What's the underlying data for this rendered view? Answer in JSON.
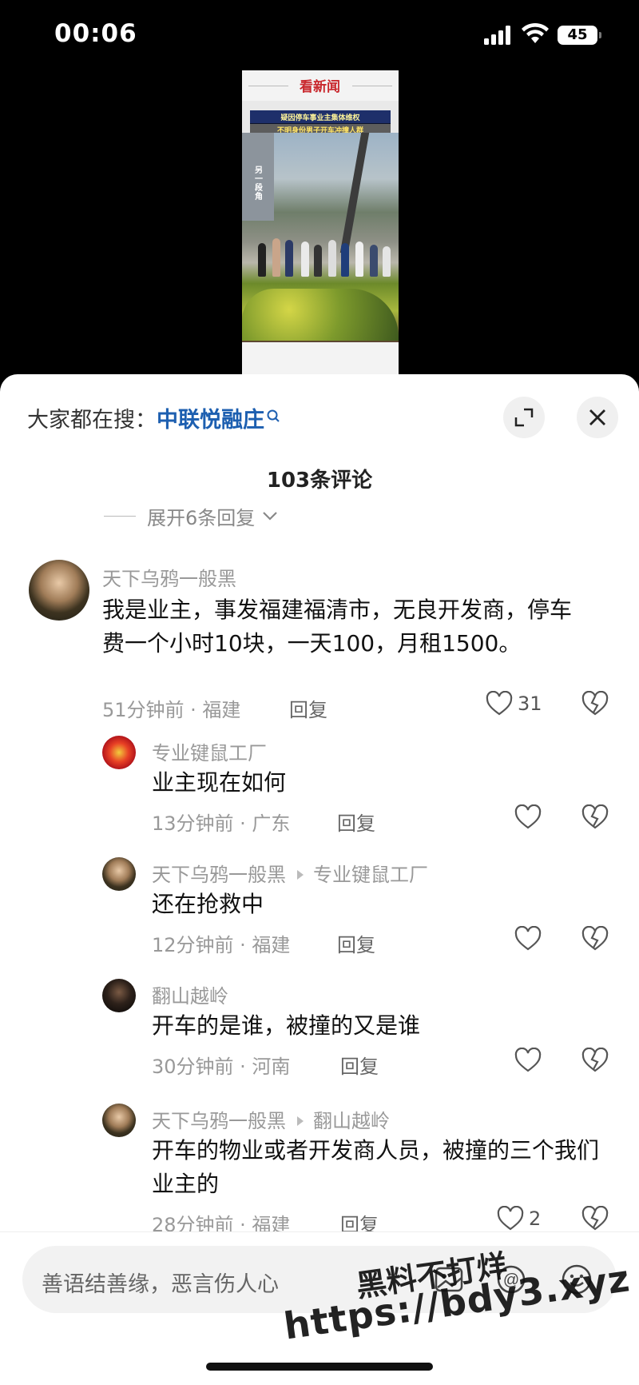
{
  "status": {
    "time": "00:06",
    "battery": "45"
  },
  "video": {
    "logo": "看新闻",
    "caption_line1": "疑因停车事业主集体维权",
    "caption_line2": "不明身份男子开车冲撞人群",
    "side_caption": "另一段角"
  },
  "search": {
    "prefix": "大家都在搜：",
    "term": "中联悦融庄"
  },
  "comments_title": "103条评论",
  "expand_replies": "展开6条回复",
  "comments": [
    {
      "username": "天下乌鸦一般黑",
      "text": "我是业主，事发福建福清市，无良开发商，停车费一个小时10块，一天100，月租1500。",
      "meta": "51分钟前 · 福建",
      "reply": "回复",
      "likes": "31"
    },
    {
      "username": "专业键鼠工厂",
      "text": "业主现在如何",
      "meta": "13分钟前 · 广东",
      "reply": "回复",
      "likes": ""
    },
    {
      "username": "天下乌鸦一般黑",
      "reply_to": "专业键鼠工厂",
      "text": "还在抢救中",
      "meta": "12分钟前 · 福建",
      "reply": "回复",
      "likes": ""
    },
    {
      "username": "翻山越岭",
      "text": "开车的是谁，被撞的又是谁",
      "meta": "30分钟前 · 河南",
      "reply": "回复",
      "likes": ""
    },
    {
      "username": "天下乌鸦一般黑",
      "reply_to": "翻山越岭",
      "text": "开车的物业或者开发商人员，被撞的三个我们业主的",
      "meta": "28分钟前 · 福建",
      "reply": "回复",
      "likes": "2"
    }
  ],
  "input": {
    "placeholder": "善语结善缘，恶言伤人心"
  },
  "watermark": {
    "line1": "黑料不打烊",
    "line2": "https://bdy3.xyz"
  },
  "colors": {
    "accent_blue": "#1d5fb0",
    "muted": "#999999",
    "sheet_bg": "#ffffff"
  }
}
